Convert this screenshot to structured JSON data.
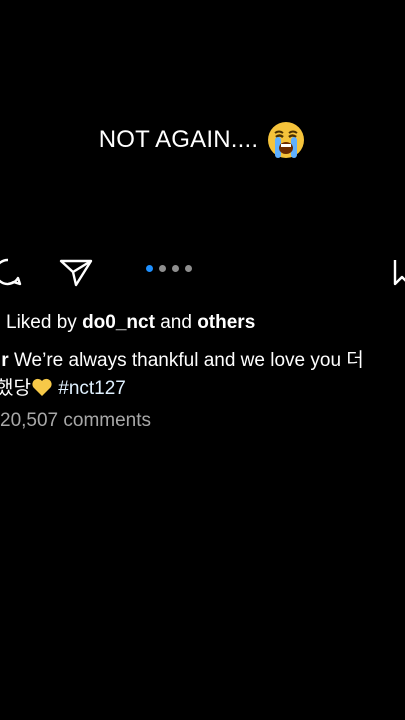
{
  "overlay": {
    "text": "NOT AGAIN....",
    "emoji": "loudly-crying-face-emoji"
  },
  "actions": {
    "comment_icon": "comment-bubble-icon",
    "share_icon": "paper-plane-icon",
    "save_icon": "bookmark-icon",
    "carousel_total": 4,
    "carousel_active_index": 0
  },
  "likes": {
    "prefix": "Liked by",
    "user": "do0_nct",
    "conjunction": "and",
    "others": "others"
  },
  "caption": {
    "username": "ir",
    "text_line1": "We’re always thankful and we love you 더",
    "text_line2_prefix": "했당",
    "emoji": "yellow-heart-emoji",
    "hashtag": "#nct127"
  },
  "comments": {
    "label": "20,507 comments"
  },
  "colors": {
    "background": "#000000",
    "text": "#ffffff",
    "muted": "#a8a8a8",
    "dot_active": "#1e90ff",
    "dot_inactive": "#8e8e8e"
  }
}
